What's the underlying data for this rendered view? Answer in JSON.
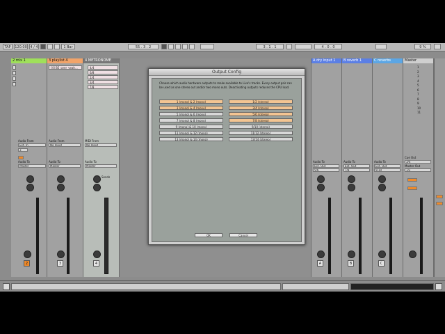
{
  "control_bar": {
    "tap": "TAP",
    "tempo": "120.00",
    "time_sig": "4 / 4",
    "quant": "1 Bar",
    "position": "55 . 3 . 2",
    "loop_start": "3 . 1 . 1",
    "loop_length": "4 . 0 . 0",
    "cpu": "9 %"
  },
  "tracks": [
    {
      "name": "2 mix 1",
      "color": "#9fe05a",
      "number": "2",
      "io_from": "Ext. In",
      "io_chan": "3",
      "io_to": "Master"
    },
    {
      "name": "3 playlist 4",
      "color": "#f2a46a",
      "number": "3",
      "clip": "[4] BE_over_yeah...",
      "io_from": "No Input",
      "io_to": "Master"
    },
    {
      "name": "4 METRONOME",
      "color": "#9b9b9b",
      "number": "4",
      "io_from": "No Input",
      "io_to": "Master",
      "midi_label": "MIDI From"
    },
    {
      "name": "A dry input 1",
      "color": "#5b7fe5",
      "letter": "A",
      "io_to": "Ext. Out",
      "io_chan": "5/6"
    },
    {
      "name": "B reverb 1",
      "color": "#5b7fe5",
      "letter": "B",
      "io_to": "Ext. Out",
      "io_chan": "7/8"
    },
    {
      "name": "C reverbs",
      "color": "#5ba6e5",
      "letter": "C",
      "io_to": "Ext. Out",
      "io_chan": "9/10"
    },
    {
      "name": "Master",
      "color": "#cfcfcf",
      "cue_label": "Cue Out",
      "cue_value": "3/4",
      "master_label": "Master Out",
      "master_value": "1/2"
    }
  ],
  "metronome_clips": [
    "4/4",
    "6/8",
    "2/4",
    "3/4",
    "7/8"
  ],
  "master_scenes": [
    "1",
    "2",
    "3",
    "4",
    "5",
    "6",
    "7",
    "8",
    "9",
    "10",
    "11"
  ],
  "io_labels": {
    "audio_from": "Audio From",
    "audio_to": "Audio To",
    "sends": "Sends"
  },
  "dialog": {
    "title": "Output Config",
    "description": "Choose which audio hardware outputs to make available to Live's tracks. Every output pair can be used as one stereo out and/or two mono outs. Deactivating outputs reduces the CPU load.",
    "mono": [
      "1 (mono) & 2 (mono)",
      "3 (mono) & 4 (mono)",
      "5 (mono) & 6 (mono)",
      "7 (mono) & 8 (mono)",
      "9 (mono) & 10 (mono)",
      "11 (mono) & 12 (mono)",
      "13 (mono) & 14 (mono)"
    ],
    "stereo": [
      "1/2 (stereo)",
      "3/4 (stereo)",
      "5/6 (stereo)",
      "7/8 (stereo)",
      "9/10 (stereo)",
      "11/12 (stereo)",
      "13/14 (stereo)"
    ],
    "mono_active": [
      true,
      true,
      false,
      false,
      false,
      false,
      false
    ],
    "stereo_active": [
      true,
      true,
      true,
      true,
      false,
      false,
      false
    ],
    "ok": "OK",
    "cancel": "Cancel"
  },
  "scale": [
    "0",
    "6",
    "12",
    "24",
    "36",
    "48",
    "60"
  ],
  "colors": {
    "accent_orange": "#f08a2a",
    "button_on": "#f3c592",
    "panel_bg": "#9aa19c"
  }
}
